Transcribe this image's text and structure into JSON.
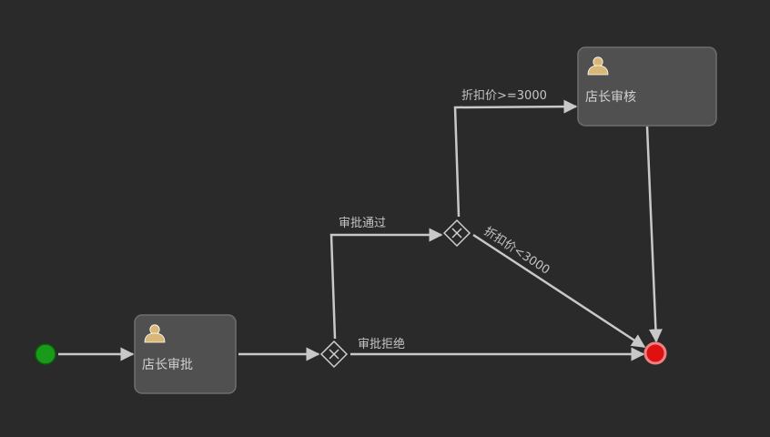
{
  "tasks": {
    "manager_approve": {
      "label": "店长审批",
      "icon": "user-icon"
    },
    "manager_review": {
      "label": "店长审核",
      "icon": "user-icon"
    }
  },
  "flows": {
    "approved": "审批通过",
    "rejected": "审批拒绝",
    "discount_high": "折扣价>=3000",
    "discount_low": "折扣价<3000"
  },
  "colors": {
    "background": "#2a2a2a",
    "edge": "#c8c8c8",
    "task_fill": "#505050",
    "start_event": "#1a9a1a",
    "end_event": "#dd1111",
    "user_icon": "#d9b877"
  }
}
